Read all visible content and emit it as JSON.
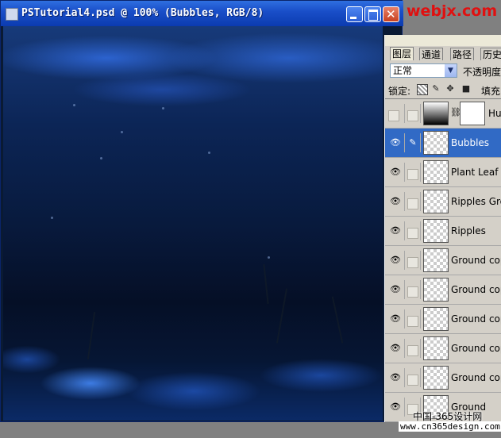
{
  "window": {
    "title": "PSTutorial4.psd @ 100% (Bubbles, RGB/8)"
  },
  "watermark": {
    "top": "webjx.com",
    "cn": "中国-365设计网",
    "url": "www.cn365design.com"
  },
  "panel": {
    "tabs": [
      "图层",
      "通道",
      "路径",
      "历史"
    ],
    "blend_mode": "正常",
    "opacity_label": "不透明度",
    "lock_label": "锁定:",
    "fill_label": "填充",
    "layers": [
      {
        "name": "Hu",
        "type": "adjustment",
        "visible": false,
        "selected": false
      },
      {
        "name": "Bubbles",
        "type": "pixel",
        "visible": true,
        "selected": true
      },
      {
        "name": "Plant Leaf",
        "type": "pixel",
        "visible": true,
        "selected": false
      },
      {
        "name": "Ripples Grou",
        "type": "pixel",
        "visible": true,
        "selected": false
      },
      {
        "name": "Ripples",
        "type": "pixel",
        "visible": true,
        "selected": false
      },
      {
        "name": "Ground cop",
        "type": "pixel",
        "visible": true,
        "selected": false
      },
      {
        "name": "Ground cop",
        "type": "pixel",
        "visible": true,
        "selected": false
      },
      {
        "name": "Ground cop",
        "type": "pixel",
        "visible": true,
        "selected": false
      },
      {
        "name": "Ground cop",
        "type": "pixel",
        "visible": true,
        "selected": false
      },
      {
        "name": "Ground cop",
        "type": "pixel",
        "visible": true,
        "selected": false
      },
      {
        "name": "Ground",
        "type": "pixel",
        "visible": true,
        "selected": false
      }
    ]
  },
  "icons": {
    "eye": "eye-icon",
    "brush": "brush-icon",
    "chain": "chain-link-icon"
  },
  "colors": {
    "titlebar": "#1a4fc9",
    "selection": "#316ac5",
    "watermark": "#e01010"
  }
}
